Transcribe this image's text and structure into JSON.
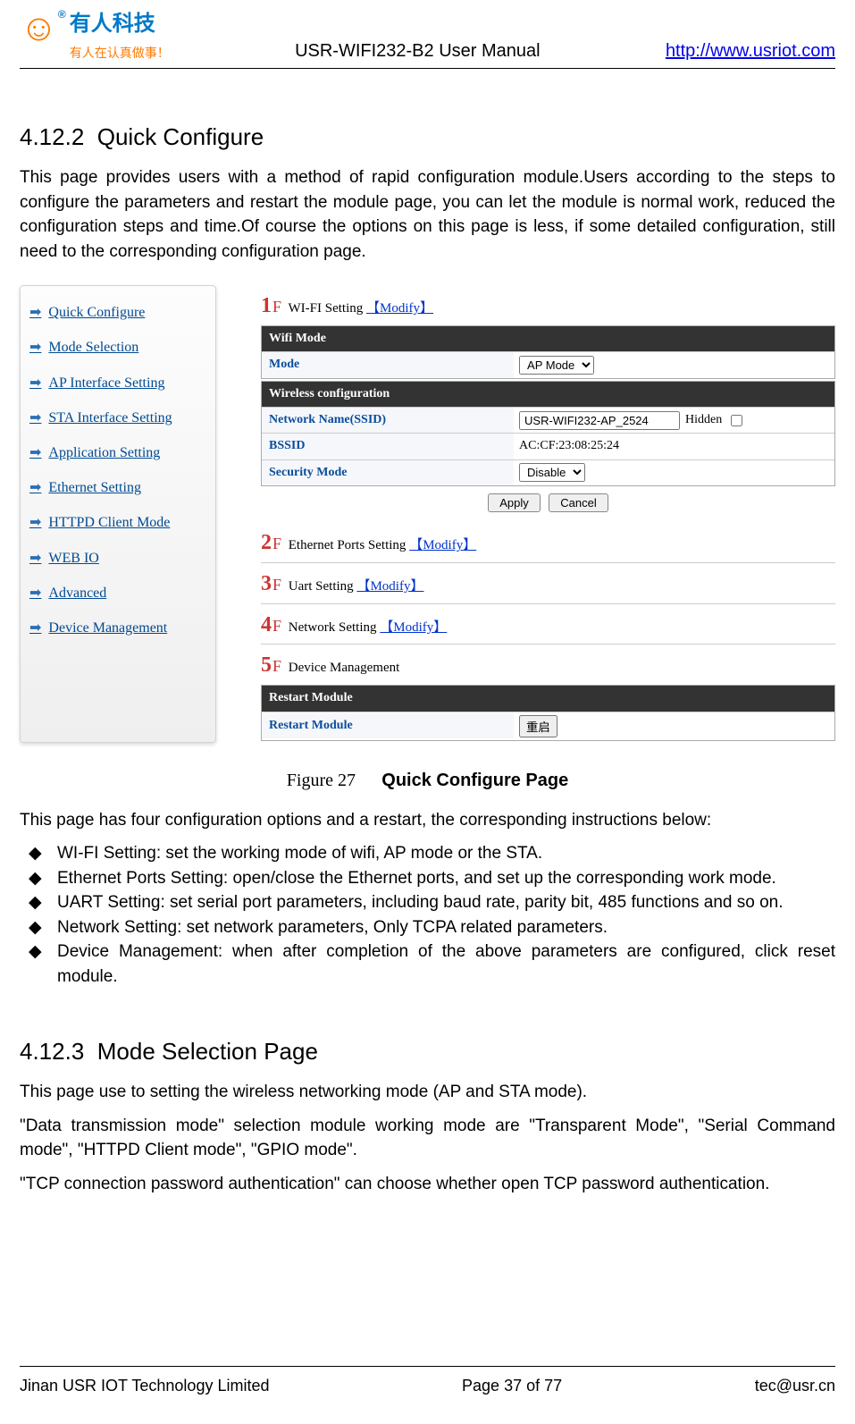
{
  "header": {
    "logo_cn": "有人科技",
    "logo_sub": "有人在认真做事！",
    "title": "USR-WIFI232-B2 User Manual",
    "link": "http://www.usriot.com"
  },
  "sections": {
    "s1": {
      "num": "4.12.2",
      "title": "Quick Configure"
    },
    "s2": {
      "num": "4.12.3",
      "title": "Mode Selection Page"
    }
  },
  "paragraphs": {
    "p1": "This page provides users with a method of rapid configuration module.Users according to the steps to configure the parameters and restart the module page, you can let the module is normal work, reduced the configuration steps and time.Of course the options on this page is less, if some detailed configuration, still need to the corresponding configuration page.",
    "p2": "This page has four configuration options and a restart, the corresponding instructions below:",
    "p3": "This page use to setting the wireless networking mode (AP and STA mode).",
    "p4": "\"Data transmission mode\" selection module working mode are \"Transparent Mode\", \"Serial Command mode\", \"HTTPD Client mode\", \"GPIO mode\".",
    "p5": "\"TCP connection password authentication\" can choose whether open TCP password authentication."
  },
  "bullets": {
    "b1": "WI-FI Setting: set the working mode of wifi, AP mode or the STA.",
    "b2": "Ethernet Ports Setting: open/close the Ethernet ports, and set up the corresponding work mode.",
    "b3": "UART Setting: set serial port parameters, including baud rate, parity bit, 485 functions and so on.",
    "b4": "Network Setting: set network parameters, Only TCPA related parameters.",
    "b5": "Device Management: when after completion of the above parameters are configured, click reset module."
  },
  "figure": {
    "label": "Figure 27",
    "title": "Quick Configure Page"
  },
  "nav": {
    "items": [
      "Quick Configure",
      "Mode Selection",
      "AP Interface Setting",
      "STA Interface Setting",
      "Application Setting",
      "Ethernet Setting",
      "HTTPD Client Mode",
      "WEB IO",
      "Advanced",
      "Device Management"
    ]
  },
  "steps": {
    "s1": {
      "num": "1",
      "title": "WI-FI Setting",
      "modify": "Modify"
    },
    "s2": {
      "num": "2",
      "title": "Ethernet Ports Setting",
      "modify": "Modify"
    },
    "s3": {
      "num": "3",
      "title": "Uart Setting",
      "modify": "Modify"
    },
    "s4": {
      "num": "4",
      "title": "Network Setting",
      "modify": "Modify"
    },
    "s5": {
      "num": "5",
      "title": "Device Management"
    }
  },
  "wifi": {
    "mode_bar": "Wifi Mode",
    "mode_label": "Mode",
    "mode_value": "AP Mode",
    "wconf_bar": "Wireless configuration",
    "ssid_label": "Network Name(SSID)",
    "ssid_value": "USR-WIFI232-AP_2524",
    "hidden_label": "Hidden",
    "bssid_label": "BSSID",
    "bssid_value": "AC:CF:23:08:25:24",
    "sec_label": "Security Mode",
    "sec_value": "Disable",
    "apply": "Apply",
    "cancel": "Cancel"
  },
  "restart": {
    "bar": "Restart Module",
    "label": "Restart Module",
    "button": "重启"
  },
  "footer": {
    "left": "Jinan USR IOT Technology Limited",
    "center": "Page 37 of 77",
    "right": "tec@usr.cn"
  }
}
